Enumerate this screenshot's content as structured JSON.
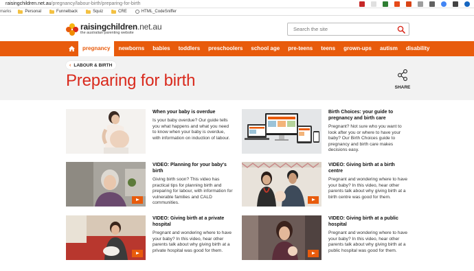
{
  "browser": {
    "url_domain": "raisingchildren.net.au",
    "url_path": "/pregnancy/labour-birth/preparing-for-birth",
    "bookmarks_label": "marks",
    "bookmarks": [
      "Personal",
      "Funnelback",
      "Squiz",
      "CRE",
      "HTML_CodeSniffer"
    ]
  },
  "site": {
    "logo_name": "raisingchildren",
    "logo_tld": ".net.au",
    "logo_tagline": "the australian parenting website",
    "search_placeholder": "Search the site"
  },
  "nav": {
    "items": [
      "pregnancy",
      "newborns",
      "babies",
      "toddlers",
      "preschoolers",
      "school age",
      "pre-teens",
      "teens",
      "grown-ups",
      "autism",
      "disability"
    ],
    "active": "pregnancy"
  },
  "page": {
    "breadcrumb": "LABOUR & BIRTH",
    "title": "Preparing for birth",
    "share_label": "SHARE"
  },
  "articles": [
    {
      "title": "When your baby is overdue",
      "desc": "Is your baby overdue? Our guide tells you what happens and what you need to know when your baby is overdue, with information on induction of labour.",
      "video": false
    },
    {
      "title": "Birth Choices: your guide to pregnancy and birth care",
      "desc": "Pregnant? Not sure who you want to look after you or where to have your baby? Our Birth Choices guide to pregnancy and birth care makes decisions easy.",
      "video": false
    },
    {
      "title": "VIDEO: Planning for your baby's birth",
      "desc": "Giving birth soon? This video has practical tips for planning birth and preparing for labour, with information for vulnerable families and CALD communities.",
      "video": true
    },
    {
      "title": "VIDEO: Giving birth at a birth centre",
      "desc": "Pregnant and wondering where to have your baby? In this video, hear other parents talk about why giving birth at a birth centre was good for them.",
      "video": true
    },
    {
      "title": "VIDEO: Giving birth at a private hospital",
      "desc": "Pregnant and wondering where to have your baby? In this video, hear other parents talk about why giving birth at a private hospital was good for them.",
      "video": true
    },
    {
      "title": "VIDEO: Giving birth at a public hospital",
      "desc": "Pregnant and wondering where to have your baby? In this video, hear other parents talk about why giving birth at a public hospital was good for them.",
      "video": true
    }
  ],
  "colors": {
    "brand_orange": "#e85b0c",
    "title_red": "#d9291c",
    "band_gray": "#f2f2f2"
  }
}
